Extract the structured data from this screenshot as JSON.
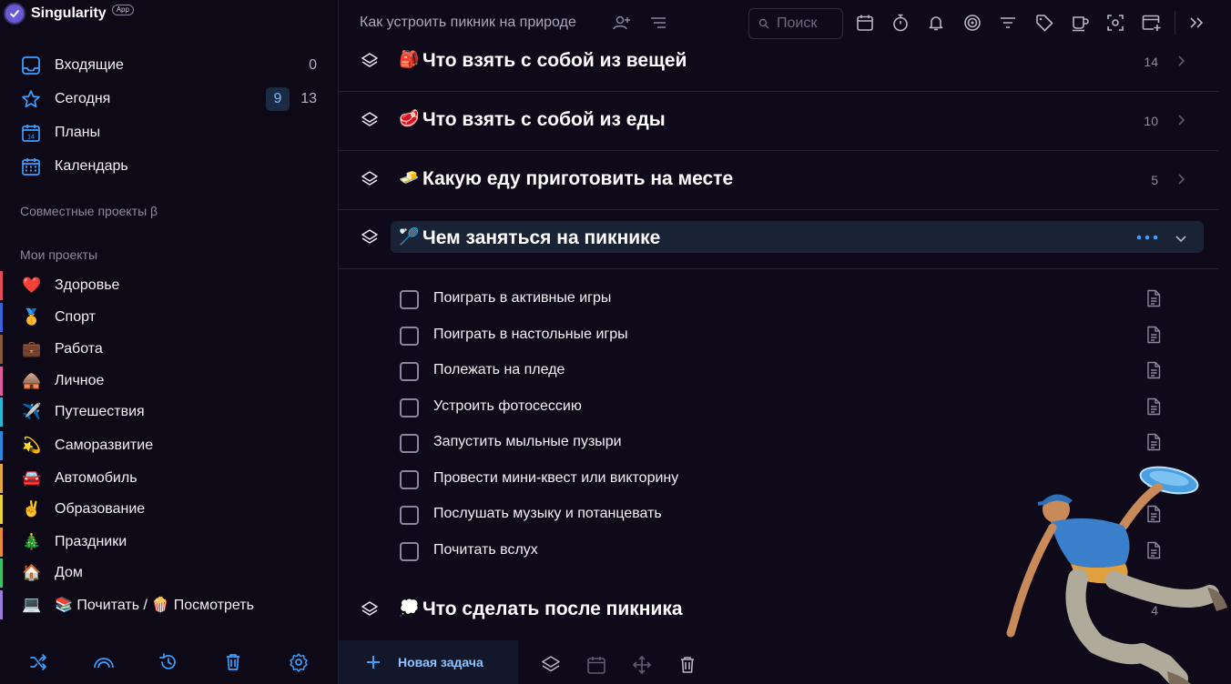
{
  "app": {
    "name": "Singularity",
    "badge": "App"
  },
  "nav": [
    {
      "label": "Входящие",
      "icon": "inbox-icon",
      "count": "0"
    },
    {
      "label": "Сегодня",
      "icon": "star-icon",
      "badge": "9",
      "count": "13"
    },
    {
      "label": "Планы",
      "icon": "calendar-day-icon",
      "day": "14"
    },
    {
      "label": "Календарь",
      "icon": "calendar-grid-icon"
    }
  ],
  "sections": {
    "shared": "Совместные проекты β",
    "mine": "Мои проекты"
  },
  "projects": [
    {
      "emoji": "❤️",
      "label": "Здоровье",
      "color": "#e24a5a"
    },
    {
      "emoji": "🥇",
      "label": "Спорт",
      "color": "#3d63d8"
    },
    {
      "emoji": "💼",
      "label": "Работа",
      "color": "#8a5a3c"
    },
    {
      "emoji": "🛖",
      "label": "Личное",
      "color": "#e05aa0"
    },
    {
      "emoji": "✈️",
      "label": "Путешествия",
      "color": "#28b9d2"
    },
    {
      "emoji": "💫",
      "label": "Саморазвитие",
      "color": "#2f86e0"
    },
    {
      "emoji": "🚘",
      "label": "Автомобиль",
      "color": "#e4a93a"
    },
    {
      "emoji": "✌️",
      "label": "Образование",
      "color": "#e8d23a"
    },
    {
      "emoji": "🎄",
      "label": "Праздники",
      "color": "#e88a3a"
    },
    {
      "emoji": "🏠",
      "label": "Дом",
      "color": "#3cc06a"
    },
    {
      "emoji": "💻",
      "label": "📚 Почитать / 🍿 Посмотреть",
      "color": "#9a7ad8"
    }
  ],
  "bottom_icons": [
    "shuffle-icon",
    "rainbow-icon",
    "history-icon",
    "trash-icon",
    "settings-icon"
  ],
  "header": {
    "breadcrumb": "Как устроить пикник на природе",
    "search_placeholder": "Поиск"
  },
  "groups": [
    {
      "emoji": "🎒",
      "title": "Что взять с собой из вещей",
      "count": "14",
      "expanded": false
    },
    {
      "emoji": "🥩",
      "title": "Что взять с собой из еды",
      "count": "10",
      "expanded": false
    },
    {
      "emoji": "🧈",
      "title": "Какую еду приготовить на месте",
      "count": "5",
      "expanded": false
    },
    {
      "emoji": "🏸",
      "title": "Чем заняться на пикнике",
      "count": "",
      "expanded": true
    },
    {
      "emoji": "💭",
      "title": "Что сделать после пикника",
      "count": "4",
      "expanded": false
    }
  ],
  "tasks": [
    "Поиграть в активные игры",
    "Поиграть в настольные игры",
    "Полежать на пледе",
    "Устроить фотосессию",
    "Запустить мыльные пузыри",
    "Провести мини-квест или викторину",
    "Послушать музыку и потанцевать",
    "Почитать вслух"
  ],
  "footer": {
    "new_task": "Новая задача"
  },
  "colors": {
    "accent": "#3aa0ff",
    "background": "#0f0a1a",
    "sidebar": "#0d0916"
  }
}
